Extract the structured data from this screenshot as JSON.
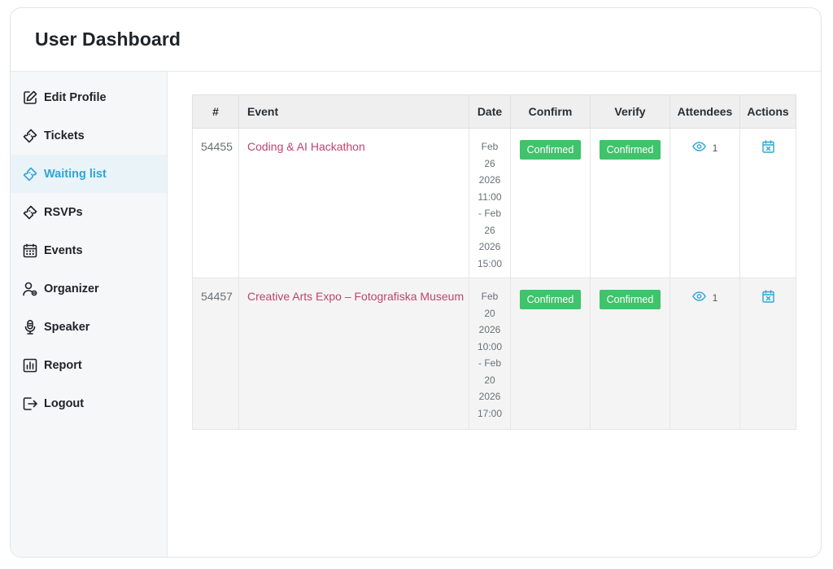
{
  "header": {
    "title": "User Dashboard"
  },
  "colors": {
    "accent": "#2fa5d6",
    "link": "#c0446d",
    "confirmed": "#3fc36b"
  },
  "sidebar": {
    "items": [
      {
        "label": "Edit Profile",
        "icon": "edit-icon"
      },
      {
        "label": "Tickets",
        "icon": "ticket-icon"
      },
      {
        "label": "Waiting list",
        "icon": "ticket-icon",
        "active": true
      },
      {
        "label": "RSVPs",
        "icon": "ticket-icon"
      },
      {
        "label": "Events",
        "icon": "calendar-icon"
      },
      {
        "label": "Organizer",
        "icon": "organizer-icon"
      },
      {
        "label": "Speaker",
        "icon": "microphone-icon"
      },
      {
        "label": "Report",
        "icon": "report-icon"
      },
      {
        "label": "Logout",
        "icon": "logout-icon"
      }
    ]
  },
  "table": {
    "columns": [
      "#",
      "Event",
      "Date",
      "Confirm",
      "Verify",
      "Attendees",
      "Actions"
    ],
    "rows": [
      {
        "id": "54455",
        "event": "Coding & AI Hackathon",
        "date_lines": [
          "Feb",
          "26",
          "2026",
          "11:00",
          "- Feb",
          "26",
          "2026",
          "15:00"
        ],
        "confirm": "Confirmed",
        "verify": "Confirmed",
        "attendees": "1"
      },
      {
        "id": "54457",
        "event": "Creative Arts Expo – Fotografiska Museum",
        "date_lines": [
          "Feb",
          "20",
          "2026",
          "10:00",
          "- Feb",
          "20",
          "2026",
          "17:00"
        ],
        "confirm": "Confirmed",
        "verify": "Confirmed",
        "attendees": "1"
      }
    ]
  }
}
